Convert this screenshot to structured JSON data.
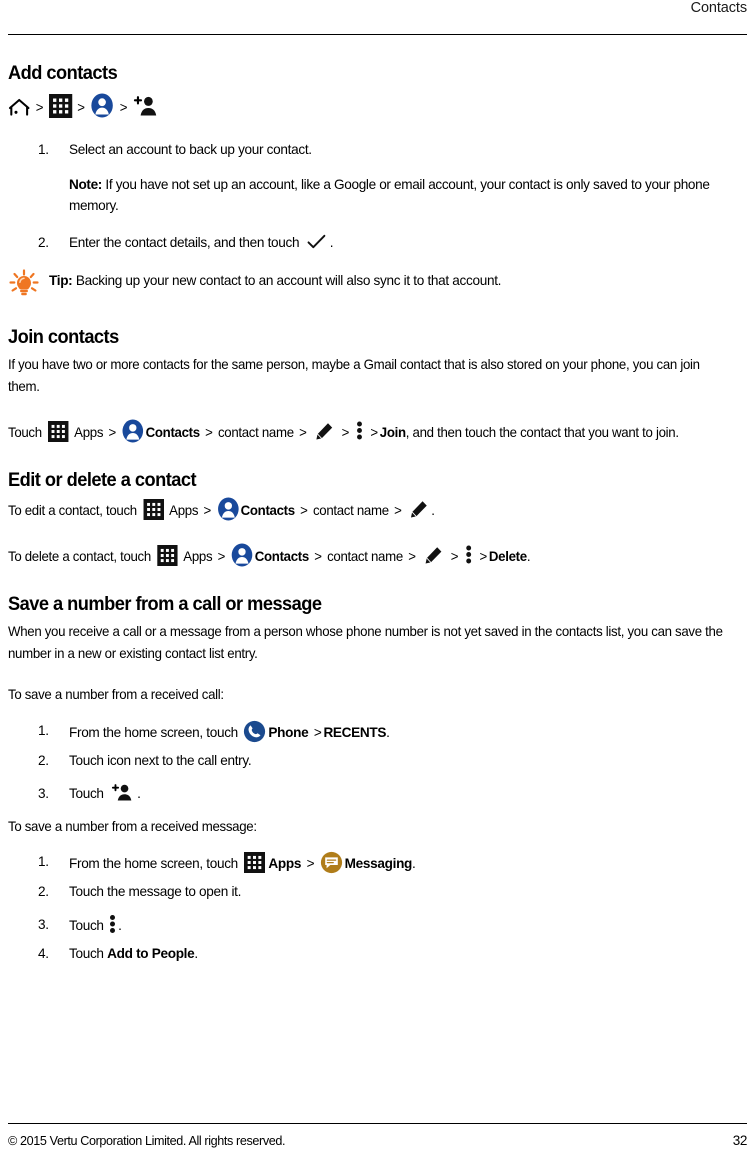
{
  "header": {
    "title": "Contacts"
  },
  "sections": {
    "add_contacts": {
      "heading": "Add contacts",
      "breadcrumb_icons": [
        "home-icon",
        "apps-grid-icon",
        "contacts-app-icon",
        "add-person-icon"
      ],
      "steps": [
        "Select an account to back up your contact.",
        "Enter the contact details, and then touch"
      ],
      "step2_suffix": ".",
      "note_label": "Note:",
      "note_text": " If you have not set up an account, like a Google or email account, your contact is only saved to your phone memory.",
      "tip_label": "Tip:",
      "tip_text": " Backing up your new contact to an account will also sync it to that account."
    },
    "join_contacts": {
      "heading": "Join contacts",
      "intro": "If you have two or more contacts for the same person, maybe a Gmail contact that is also stored on your phone, you can join them.",
      "path_prefix": "Touch",
      "apps_label": "Apps",
      "contacts_label": "Contacts",
      "contact_name_label": "contact name",
      "join_label": "Join",
      "path_suffix": ", and then touch the contact that you want to join."
    },
    "edit_delete": {
      "heading": "Edit or delete a contact",
      "edit_prefix": "To edit a contact, touch",
      "delete_prefix": "To delete a contact, touch",
      "apps_label": "Apps",
      "contacts_label": "Contacts",
      "contact_name_label": "contact name",
      "delete_label": "Delete",
      "period": "."
    },
    "save_number": {
      "heading": "Save a number from a call or message",
      "intro": "When you receive a call or a message from a person whose phone number is not yet saved in the contacts list, you can save the number in a new or existing contact list entry.",
      "call_lead": "To save a number from a received call:",
      "call_steps": {
        "s1_prefix": "From the home screen, touch",
        "s1_phone_label": "Phone",
        "s1_recents_label": "RECENTS",
        "s1_suffix": ".",
        "s2": "Touch icon next to the call entry.",
        "s3_prefix": "Touch",
        "s3_suffix": "."
      },
      "message_lead": "To save a number from a received message:",
      "message_steps": {
        "s1_prefix": "From the home screen, touch",
        "s1_apps_label": "Apps",
        "s1_messaging_label": "Messaging",
        "s1_suffix": ".",
        "s2": "Touch the message to open it.",
        "s3_prefix": "Touch",
        "s3_suffix": ".",
        "s4_prefix": "Touch",
        "s4_bold": "Add to People",
        "s4_suffix": "."
      }
    }
  },
  "separators": {
    "chevron": ">"
  },
  "footer": {
    "copyright": "© 2015 Vertu Corporation Limited. All rights reserved.",
    "page_number": "32"
  },
  "colors": {
    "contacts_blue": "#19499b",
    "phone_blue": "#1b4a8e",
    "messaging_gold": "#b07d1a",
    "tip_orange": "#ef7622",
    "rule_black": "#000000"
  }
}
